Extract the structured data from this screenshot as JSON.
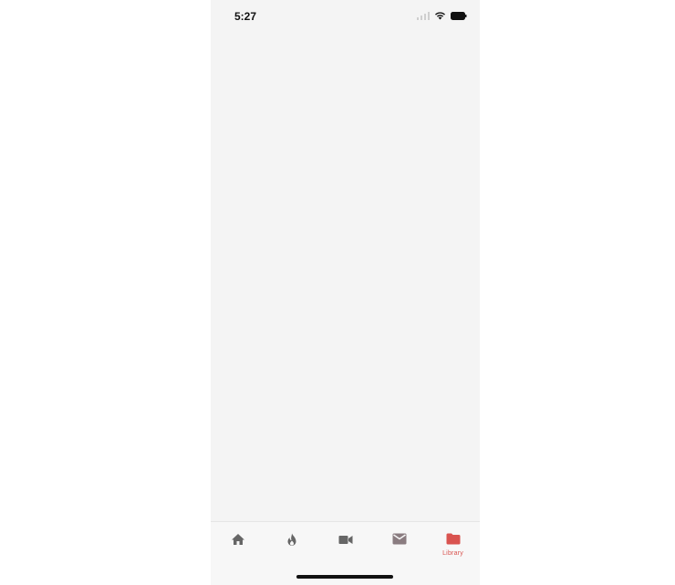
{
  "status_bar": {
    "time": "5:27",
    "icons": [
      "signal-icon",
      "wifi-icon",
      "battery-icon"
    ]
  },
  "tab_bar": {
    "active_color": "#d9534f",
    "inactive_color": "#666666",
    "tabs": [
      {
        "icon": "home-icon",
        "label": ""
      },
      {
        "icon": "fire-icon",
        "label": ""
      },
      {
        "icon": "video-camera-icon",
        "label": ""
      },
      {
        "icon": "mail-icon",
        "label": ""
      },
      {
        "icon": "folder-icon",
        "label": "Library",
        "active": true
      }
    ]
  }
}
